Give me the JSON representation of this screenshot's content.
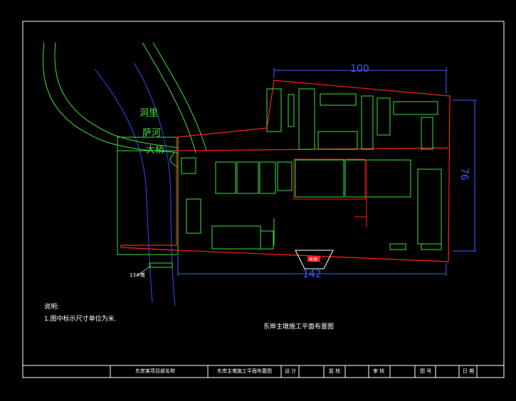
{
  "labels": {
    "place_top": "洞里",
    "river": "萨河",
    "bridge": "大桥",
    "dim_top": "100",
    "dim_right": "76",
    "dim_bottom": "142",
    "drawing_title": "东岸主墩施工平面布置图",
    "note_heading": "说明:",
    "note_line1": "1.图中标示尺寸单位为米.",
    "pier_label": "13#墩",
    "tank_label": "水池"
  },
  "title_block": {
    "project": "东岸某项目部名称",
    "drawing_name": "东岸主墩施工平面布置图",
    "design": "设 计",
    "check": "复 核",
    "review": "审 核",
    "number": "图 号",
    "date": "日 期"
  },
  "colors": {
    "background": "#000000",
    "frame": "#ffffff",
    "site_outline": "#ff2020",
    "structures": "#3ee03e",
    "river_banks": "#2f4bff",
    "dimension": "#4060ff",
    "text": "#ffffff"
  }
}
